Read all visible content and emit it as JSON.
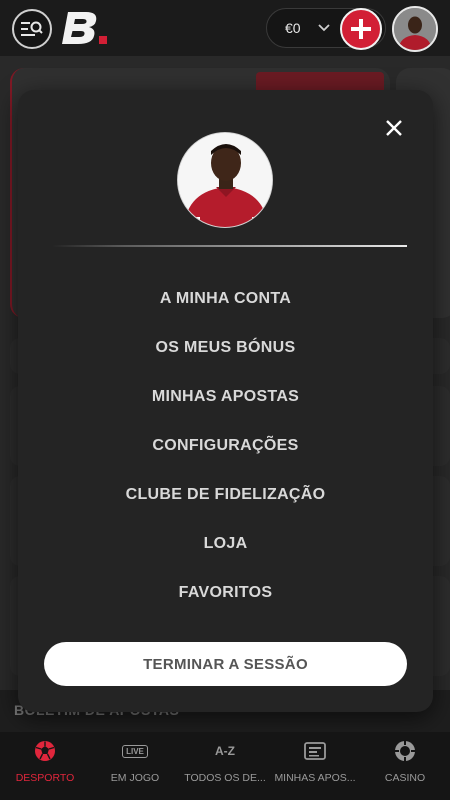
{
  "header": {
    "balance": "€0"
  },
  "menu": {
    "items": [
      {
        "label": "A MINHA CONTA"
      },
      {
        "label": "OS MEUS BÓNUS"
      },
      {
        "label": "MINHAS APOSTAS"
      },
      {
        "label": "CONFIGURAÇÕES"
      },
      {
        "label": "CLUBE DE FIDELIZAÇÃO"
      },
      {
        "label": "LOJA"
      },
      {
        "label": "FAVORITOS"
      }
    ],
    "logout_label": "TERMINAR A SESSÃO"
  },
  "background": {
    "bulletin_label": "BOLETIM DE APOSTAS"
  },
  "bottom_nav": {
    "items": [
      {
        "label": "DESPORTO",
        "icon": "soccer-ball-icon",
        "active": true
      },
      {
        "label": "EM JOGO",
        "icon": "live-icon",
        "badge": "LIVE",
        "active": false
      },
      {
        "label": "TODOS OS DE...",
        "icon": "a-z-icon",
        "badge": "A-Z",
        "active": false
      },
      {
        "label": "MINHAS APOS...",
        "icon": "bet-slip-icon",
        "active": false
      },
      {
        "label": "CASINO",
        "icon": "casino-chip-icon",
        "active": false
      }
    ]
  },
  "colors": {
    "accent": "#d21f35",
    "modal_bg": "#242424",
    "topbar_bg": "#1b1b1b"
  }
}
